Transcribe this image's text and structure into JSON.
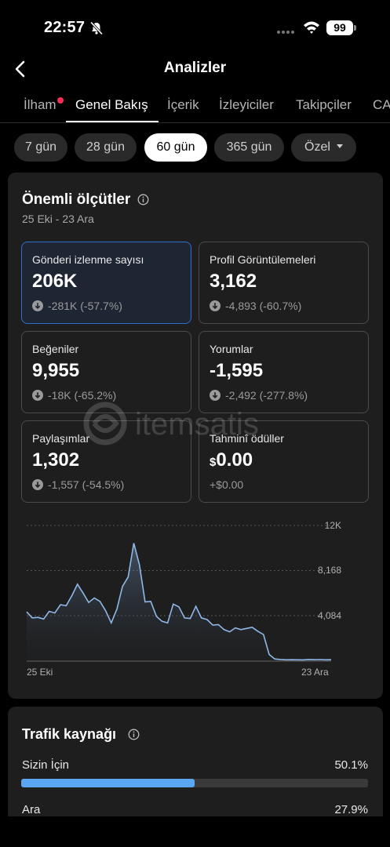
{
  "status_bar": {
    "time": "22:57",
    "battery": "99"
  },
  "header": {
    "title": "Analizler"
  },
  "tabs": [
    {
      "label": "İlham",
      "has_dot": true
    },
    {
      "label": "Genel Bakış",
      "active": true
    },
    {
      "label": "İçerik"
    },
    {
      "label": "İzleyiciler"
    },
    {
      "label": "Takipçiler"
    },
    {
      "label": "CA"
    }
  ],
  "ranges": [
    {
      "label": "7 gün"
    },
    {
      "label": "28 gün"
    },
    {
      "label": "60 gün",
      "selected": true
    },
    {
      "label": "365 gün"
    },
    {
      "label": "Özel"
    }
  ],
  "metrics_card": {
    "title": "Önemli ölçütler",
    "date_range": "25 Eki - 23 Ara",
    "items": [
      {
        "label": "Gönderi izlenme sayısı",
        "value": "206K",
        "change": "-281K (-57.7%)",
        "highlight": true
      },
      {
        "label": "Profil Görüntülemeleri",
        "value": "3,162",
        "change": "-4,893 (-60.7%)"
      },
      {
        "label": "Beğeniler",
        "value": "9,955",
        "change": "-18K (-65.2%)"
      },
      {
        "label": "Yorumlar",
        "value": "-1,595",
        "change": "-2,492 (-277.8%)"
      },
      {
        "label": "Paylaşımlar",
        "value": "1,302",
        "change": "-1,557 (-54.5%)"
      },
      {
        "label": "Tahminî ödüller",
        "currency": "$",
        "value": "0.00",
        "change": "+$0.00"
      }
    ]
  },
  "chart_data": {
    "type": "area",
    "x_start": "25 Eki",
    "x_end": "23 Ara",
    "y_ticks": [
      "12K",
      "8,168",
      "4,084"
    ],
    "ylim": [
      0,
      12252
    ],
    "values": [
      4450,
      3900,
      3950,
      3800,
      4500,
      4350,
      5100,
      5000,
      5900,
      6950,
      6150,
      5300,
      5700,
      5400,
      4550,
      3450,
      4700,
      6750,
      7600,
      10650,
      8700,
      5350,
      5400,
      4050,
      3600,
      3450,
      5150,
      4900,
      3900,
      3850,
      4950,
      3900,
      3750,
      3250,
      3300,
      2850,
      2650,
      3000,
      2850,
      2950,
      3050,
      2700,
      2400,
      600,
      200,
      150,
      120,
      130,
      120,
      110,
      150,
      130,
      140,
      120,
      130
    ],
    "color": "#8fb8e8"
  },
  "traffic_card": {
    "title": "Trafik kaynağı",
    "sources": [
      {
        "label": "Sizin İçin",
        "pct": "50.1%",
        "fraction": 0.501
      },
      {
        "label": "Ara",
        "pct": "27.9%",
        "fraction": 0.279
      }
    ],
    "accent": "#5aa6f0"
  },
  "watermark": {
    "text": "itemsatis"
  }
}
